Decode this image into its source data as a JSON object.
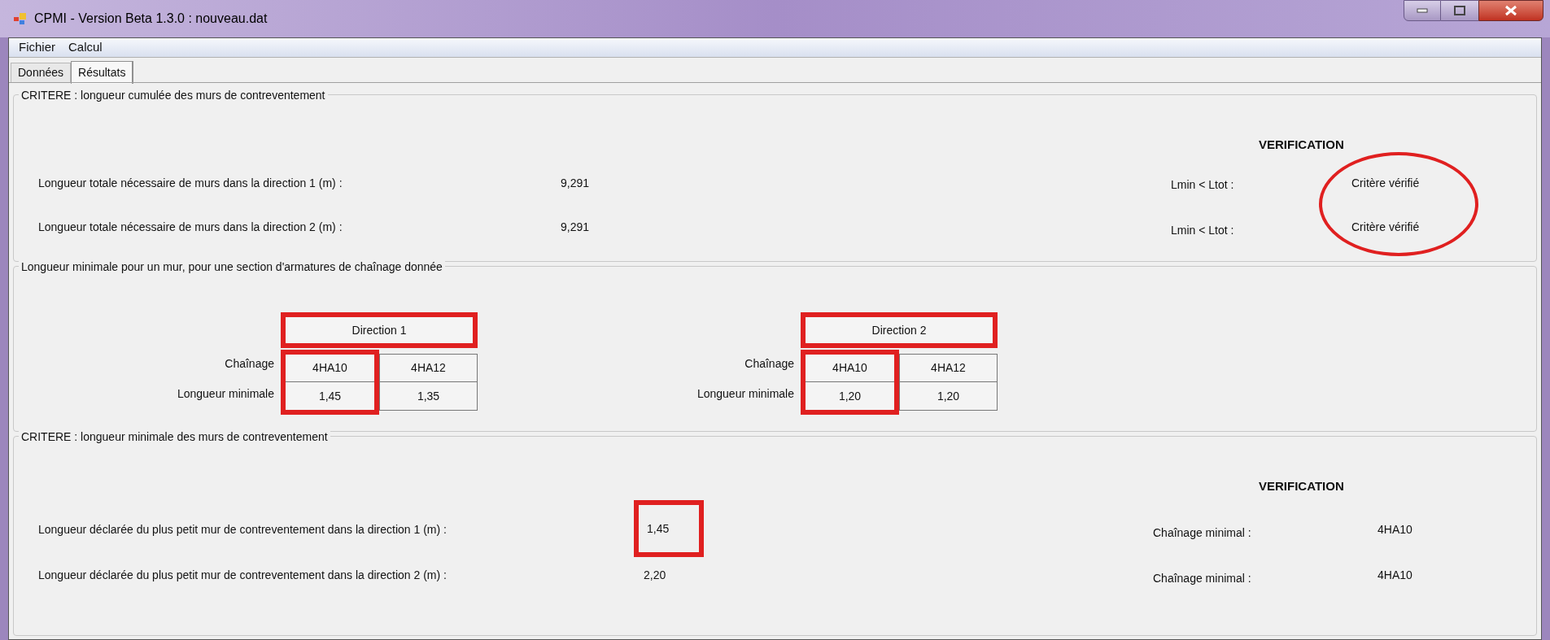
{
  "window": {
    "title": "CPMI - Version Beta 1.3.0 : nouveau.dat"
  },
  "menu": [
    "Fichier",
    "Calcul"
  ],
  "tabs": [
    {
      "label": "Données",
      "selected": false
    },
    {
      "label": "Résultats",
      "selected": true
    }
  ],
  "section_total": {
    "title": "CRITERE : longueur cumulée des murs de contreventement",
    "verification_heading": "VERIFICATION",
    "results_circled": true,
    "rows": [
      {
        "label": "Longueur totale nécessaire de murs dans la direction 1 (m) :",
        "value": "9,291",
        "check_label": "Lmin < Ltot :",
        "check_result": "Critère vérifié"
      },
      {
        "label": "Longueur totale nécessaire de murs dans la direction 2 (m) :",
        "value": "9,291",
        "check_label": "Lmin < Ltot :",
        "check_result": "Critère vérifié"
      }
    ]
  },
  "section_min_length": {
    "title": "Longueur minimale pour un mur, pour une section d'armatures de chaînage donnée",
    "tables": [
      {
        "header": "Direction 1",
        "header_highlighted": true,
        "row_labels": [
          "Chaînage",
          "Longueur minimale"
        ],
        "columns": [
          {
            "chainage": "4HA10",
            "length": "1,45",
            "highlighted": true
          },
          {
            "chainage": "4HA12",
            "length": "1,35",
            "highlighted": false
          }
        ]
      },
      {
        "header": "Direction 2",
        "header_highlighted": true,
        "row_labels": [
          "Chaînage",
          "Longueur minimale"
        ],
        "columns": [
          {
            "chainage": "4HA10",
            "length": "1,20",
            "highlighted": true
          },
          {
            "chainage": "4HA12",
            "length": "1,20",
            "highlighted": false
          }
        ]
      }
    ]
  },
  "section_min_wall": {
    "title": "CRITERE : longueur minimale des murs de contreventement",
    "verification_heading": "VERIFICATION",
    "rows": [
      {
        "label": "Longueur déclarée du plus petit mur de contreventement dans la direction 1 (m) :",
        "value": "1,45",
        "highlighted": true,
        "check_label": "Chaînage minimal :",
        "check_result": "4HA10"
      },
      {
        "label": "Longueur déclarée du plus petit mur de contreventement dans la direction 2 (m) :",
        "value": "2,20",
        "highlighted": false,
        "check_label": "Chaînage minimal :",
        "check_result": "4HA10"
      }
    ]
  }
}
